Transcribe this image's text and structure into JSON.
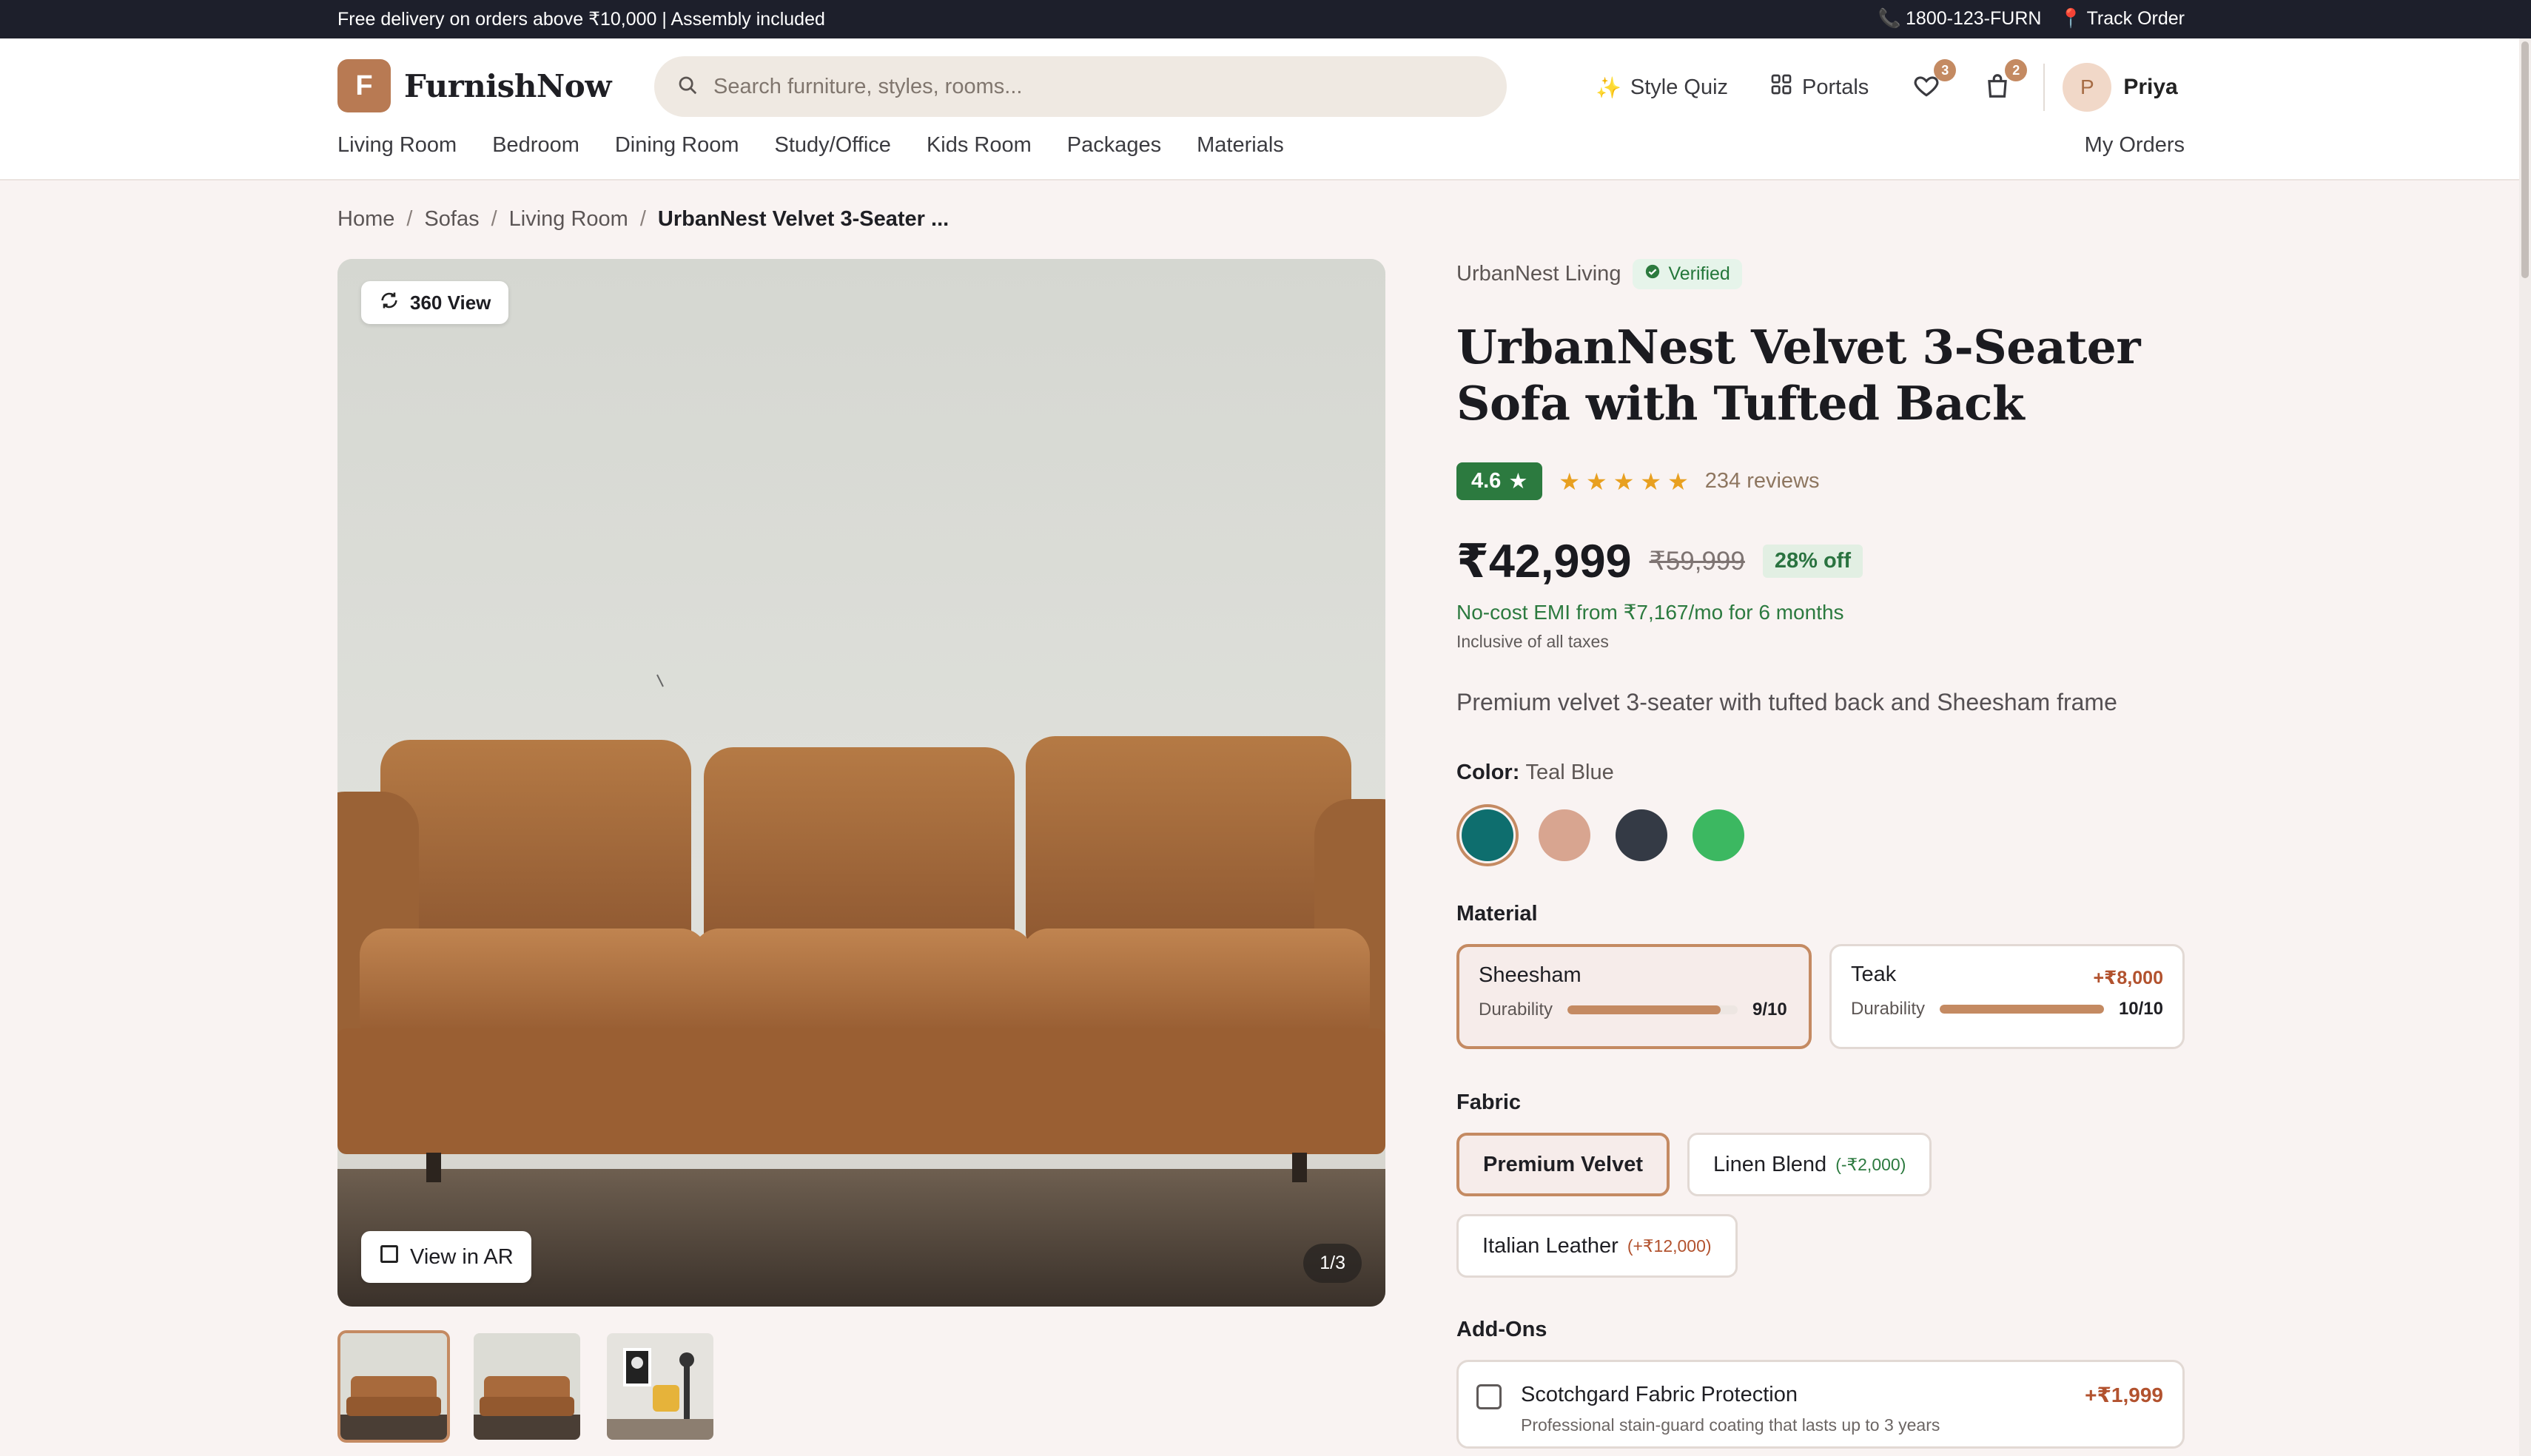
{
  "promo": {
    "text": "Free delivery on orders above ₹10,000 | Assembly included",
    "phone": "1800-123-FURN",
    "track": "Track Order"
  },
  "header": {
    "logo_letter": "F",
    "brand": "FurnishNow",
    "search_placeholder": "Search furniture, styles, rooms...",
    "style_quiz": "Style Quiz",
    "portals": "Portals",
    "wishlist_count": "3",
    "cart_count": "2",
    "avatar_letter": "P",
    "user_name": "Priya"
  },
  "nav": {
    "items": [
      "Living Room",
      "Bedroom",
      "Dining Room",
      "Study/Office",
      "Kids Room",
      "Packages",
      "Materials"
    ],
    "my_orders": "My Orders"
  },
  "breadcrumb": [
    "Home",
    "Sofas",
    "Living Room",
    "UrbanNest Velvet 3-Seater ..."
  ],
  "gallery": {
    "view360": "360 View",
    "view_ar": "View in AR",
    "counter": "1/3"
  },
  "product": {
    "seller": "UrbanNest Living",
    "verified": "Verified",
    "title": "UrbanNest Velvet 3-Seater Sofa with Tufted Back",
    "rating": "4.6",
    "stars": 5,
    "reviews": "234 reviews",
    "price": "₹42,999",
    "mrp": "₹59,999",
    "discount": "28% off",
    "emi": "No-cost EMI from ₹7,167/mo for 6 months",
    "tax_note": "Inclusive of all taxes",
    "description": "Premium velvet 3-seater with tufted back and Sheesham frame"
  },
  "color": {
    "label": "Color:",
    "selected": "Teal Blue",
    "swatches": [
      "#0e6e6e",
      "#d8a590",
      "#343a45",
      "#3cb861"
    ]
  },
  "material": {
    "label": "Material",
    "options": [
      {
        "name": "Sheesham",
        "extra": "",
        "durability_label": "Durability",
        "score": "9/10",
        "fill": 0.9
      },
      {
        "name": "Teak",
        "extra": "+₹8,000",
        "durability_label": "Durability",
        "score": "10/10",
        "fill": 1.0
      }
    ]
  },
  "fabric": {
    "label": "Fabric",
    "options": [
      {
        "name": "Premium Velvet",
        "delta": ""
      },
      {
        "name": "Linen Blend",
        "delta": "(-₹2,000)"
      },
      {
        "name": "Italian Leather",
        "delta": "(+₹12,000)"
      }
    ]
  },
  "addons": {
    "label": "Add-Ons",
    "items": [
      {
        "name": "Scotchgard Fabric Protection",
        "desc": "Professional stain-guard coating that lasts up to 3 years",
        "price": "+₹1,999"
      }
    ]
  }
}
